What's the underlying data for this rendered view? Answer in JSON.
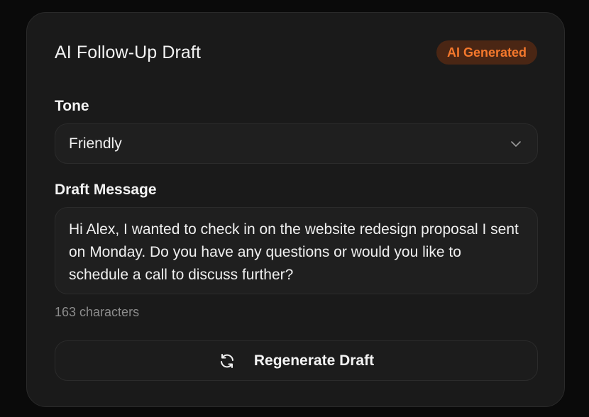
{
  "card": {
    "title": "AI Follow-Up Draft",
    "badge": "AI Generated"
  },
  "tone": {
    "label": "Tone",
    "selected": "Friendly"
  },
  "draft": {
    "label": "Draft Message",
    "message": "Hi Alex, I wanted to check in on the website redesign proposal I sent on Monday. Do you have any questions or would you like to schedule a call to discuss further?",
    "char_count": "163 characters"
  },
  "actions": {
    "regenerate_label": "Regenerate Draft"
  },
  "colors": {
    "accent": "#f5782c",
    "badge_bg": "#4a2614",
    "card_bg": "#1a1a1a",
    "page_bg": "#0a0a0a"
  },
  "icons": {
    "tone_dropdown": "chevron-down-icon",
    "regenerate": "refresh-icon"
  }
}
